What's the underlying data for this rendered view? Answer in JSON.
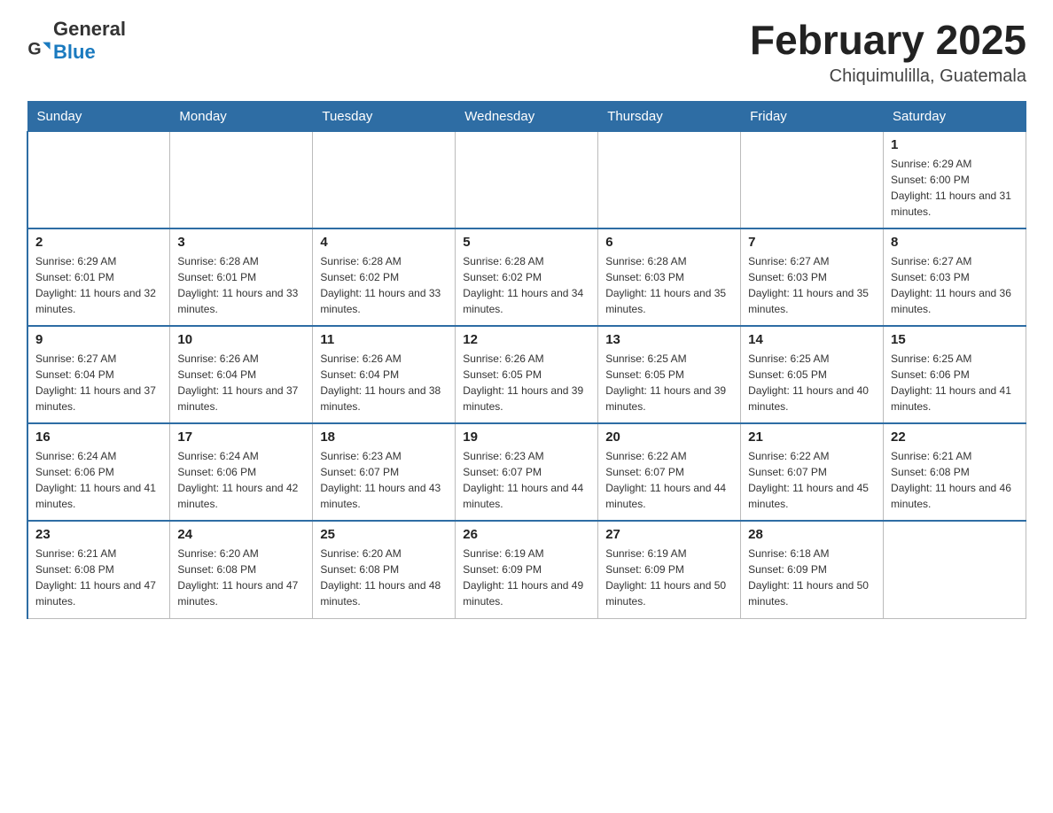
{
  "header": {
    "logo_text_general": "General",
    "logo_text_blue": "Blue",
    "month_title": "February 2025",
    "location": "Chiquimulilla, Guatemala"
  },
  "days_of_week": [
    "Sunday",
    "Monday",
    "Tuesday",
    "Wednesday",
    "Thursday",
    "Friday",
    "Saturday"
  ],
  "weeks": [
    [
      {
        "day": "",
        "info": ""
      },
      {
        "day": "",
        "info": ""
      },
      {
        "day": "",
        "info": ""
      },
      {
        "day": "",
        "info": ""
      },
      {
        "day": "",
        "info": ""
      },
      {
        "day": "",
        "info": ""
      },
      {
        "day": "1",
        "info": "Sunrise: 6:29 AM\nSunset: 6:00 PM\nDaylight: 11 hours and 31 minutes."
      }
    ],
    [
      {
        "day": "2",
        "info": "Sunrise: 6:29 AM\nSunset: 6:01 PM\nDaylight: 11 hours and 32 minutes."
      },
      {
        "day": "3",
        "info": "Sunrise: 6:28 AM\nSunset: 6:01 PM\nDaylight: 11 hours and 33 minutes."
      },
      {
        "day": "4",
        "info": "Sunrise: 6:28 AM\nSunset: 6:02 PM\nDaylight: 11 hours and 33 minutes."
      },
      {
        "day": "5",
        "info": "Sunrise: 6:28 AM\nSunset: 6:02 PM\nDaylight: 11 hours and 34 minutes."
      },
      {
        "day": "6",
        "info": "Sunrise: 6:28 AM\nSunset: 6:03 PM\nDaylight: 11 hours and 35 minutes."
      },
      {
        "day": "7",
        "info": "Sunrise: 6:27 AM\nSunset: 6:03 PM\nDaylight: 11 hours and 35 minutes."
      },
      {
        "day": "8",
        "info": "Sunrise: 6:27 AM\nSunset: 6:03 PM\nDaylight: 11 hours and 36 minutes."
      }
    ],
    [
      {
        "day": "9",
        "info": "Sunrise: 6:27 AM\nSunset: 6:04 PM\nDaylight: 11 hours and 37 minutes."
      },
      {
        "day": "10",
        "info": "Sunrise: 6:26 AM\nSunset: 6:04 PM\nDaylight: 11 hours and 37 minutes."
      },
      {
        "day": "11",
        "info": "Sunrise: 6:26 AM\nSunset: 6:04 PM\nDaylight: 11 hours and 38 minutes."
      },
      {
        "day": "12",
        "info": "Sunrise: 6:26 AM\nSunset: 6:05 PM\nDaylight: 11 hours and 39 minutes."
      },
      {
        "day": "13",
        "info": "Sunrise: 6:25 AM\nSunset: 6:05 PM\nDaylight: 11 hours and 39 minutes."
      },
      {
        "day": "14",
        "info": "Sunrise: 6:25 AM\nSunset: 6:05 PM\nDaylight: 11 hours and 40 minutes."
      },
      {
        "day": "15",
        "info": "Sunrise: 6:25 AM\nSunset: 6:06 PM\nDaylight: 11 hours and 41 minutes."
      }
    ],
    [
      {
        "day": "16",
        "info": "Sunrise: 6:24 AM\nSunset: 6:06 PM\nDaylight: 11 hours and 41 minutes."
      },
      {
        "day": "17",
        "info": "Sunrise: 6:24 AM\nSunset: 6:06 PM\nDaylight: 11 hours and 42 minutes."
      },
      {
        "day": "18",
        "info": "Sunrise: 6:23 AM\nSunset: 6:07 PM\nDaylight: 11 hours and 43 minutes."
      },
      {
        "day": "19",
        "info": "Sunrise: 6:23 AM\nSunset: 6:07 PM\nDaylight: 11 hours and 44 minutes."
      },
      {
        "day": "20",
        "info": "Sunrise: 6:22 AM\nSunset: 6:07 PM\nDaylight: 11 hours and 44 minutes."
      },
      {
        "day": "21",
        "info": "Sunrise: 6:22 AM\nSunset: 6:07 PM\nDaylight: 11 hours and 45 minutes."
      },
      {
        "day": "22",
        "info": "Sunrise: 6:21 AM\nSunset: 6:08 PM\nDaylight: 11 hours and 46 minutes."
      }
    ],
    [
      {
        "day": "23",
        "info": "Sunrise: 6:21 AM\nSunset: 6:08 PM\nDaylight: 11 hours and 47 minutes."
      },
      {
        "day": "24",
        "info": "Sunrise: 6:20 AM\nSunset: 6:08 PM\nDaylight: 11 hours and 47 minutes."
      },
      {
        "day": "25",
        "info": "Sunrise: 6:20 AM\nSunset: 6:08 PM\nDaylight: 11 hours and 48 minutes."
      },
      {
        "day": "26",
        "info": "Sunrise: 6:19 AM\nSunset: 6:09 PM\nDaylight: 11 hours and 49 minutes."
      },
      {
        "day": "27",
        "info": "Sunrise: 6:19 AM\nSunset: 6:09 PM\nDaylight: 11 hours and 50 minutes."
      },
      {
        "day": "28",
        "info": "Sunrise: 6:18 AM\nSunset: 6:09 PM\nDaylight: 11 hours and 50 minutes."
      },
      {
        "day": "",
        "info": ""
      }
    ]
  ]
}
